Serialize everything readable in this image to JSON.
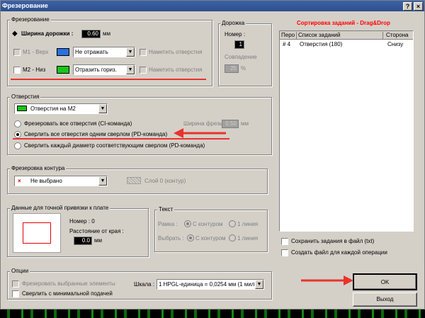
{
  "window": {
    "title": "Фрезерование",
    "help_btn": "?",
    "close_btn": "×"
  },
  "milling": {
    "group": "Фрезерование",
    "track_width_label": "Ширина дорожки :",
    "track_width_value": "0.60",
    "track_width_unit": "мм",
    "m1_label": "M1 - Верх",
    "m1_color": "#2b6fe0",
    "m1_combo": "Не отражать",
    "m1_mark": "Наметить отверстия",
    "m2_label": "M2 - Низ",
    "m2_color": "#17c617",
    "m2_combo": "Отразить гориз.",
    "m2_mark": "Наметить отверстия"
  },
  "track": {
    "group": "Дорожка",
    "number_label": "Номер :",
    "number_value": "1",
    "match_label": "Совпадение",
    "match_value": "25",
    "match_unit": "%"
  },
  "holes": {
    "group": "Отверстия",
    "combo": "Отверстия на M2",
    "combo_color": "#17c617",
    "opt1": "Фрезеровать все отверстия (CI-команда)",
    "cutter_label": "Ширина фрезы :",
    "cutter_value": "0.50",
    "cutter_unit": "мм",
    "opt2": "Сверлить все отверстия одним сверлом (PD-команда)",
    "opt3": "Сверлить каждый диаметр соответствующим сверлом (PD-команда)"
  },
  "contour": {
    "group": "Фрезеровка контура",
    "combo": "Не выбрано",
    "layer_label": "Слой 0 (контур)"
  },
  "anchor": {
    "group": "Данные для точной привязки к плате",
    "number_label": "Номер : 0",
    "distance_label": "Расстояние от края :",
    "distance_value": "0.0",
    "distance_unit": "мм"
  },
  "text": {
    "group": "Текст",
    "border_label": "Рамка :",
    "border_opt1": "С контуром",
    "border_opt2": "1 линия",
    "choose_label": "Выбрать :",
    "choose_opt1": "С контуром",
    "choose_opt2": "1 линия"
  },
  "options": {
    "group": "Опции",
    "opt1": "Фрезеровать выбранные элементы",
    "opt2": "Сверлить с минимальной подачей",
    "scale_label": "Шкала :",
    "scale_value": "1 HPGL-единица = 0,0254 мм (1 мил)"
  },
  "sort": {
    "title": "Сортировка заданий - Drag&Drop",
    "title_color": "#ff0000",
    "columns": [
      "Перо",
      "Список заданий",
      "Сторона"
    ],
    "rows": [
      {
        "pen": "# 4",
        "job": "Отверстия (180)",
        "side": "Снизу"
      }
    ],
    "save_jobs": "Сохранить задания в файл (txt)",
    "create_files": "Создать файл для каждой операции"
  },
  "buttons": {
    "ok": "OK",
    "exit": "Выход"
  },
  "annotation_color": "#e8332c"
}
